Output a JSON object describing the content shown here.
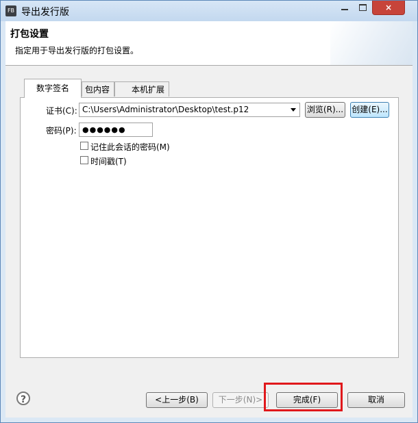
{
  "window": {
    "app_icon": "FB",
    "title": "导出发行版",
    "minimize_icon": "minimize-icon",
    "maximize_icon": "maximize-icon",
    "close_glyph": "×"
  },
  "header": {
    "title": "打包设置",
    "description": "指定用于导出发行版的打包设置。"
  },
  "tabs": [
    {
      "label": "数字签名",
      "active": true
    },
    {
      "label": "包内容",
      "active": false
    },
    {
      "label": "本机扩展",
      "active": false
    }
  ],
  "signature": {
    "cert_label": "证书(C):",
    "cert_value": "C:\\Users\\Administrator\\Desktop\\test.p12",
    "browse_label": "浏览(R)...",
    "create_label": "创建(E)...",
    "password_label": "密码(P):",
    "password_value": "●●●●●●",
    "remember_label": "记住此会话的密码(M)",
    "remember_checked": false,
    "timestamp_label": "时间戳(T)",
    "timestamp_checked": false
  },
  "footer": {
    "help_glyph": "?",
    "back_label": "<上一步(B)",
    "next_label": "下一步(N)>",
    "finish_label": "完成(F)",
    "cancel_label": "取消"
  },
  "colors": {
    "highlight": "#e0181b",
    "close_button": "#c7443a",
    "title_bar": "#c3d8ef"
  }
}
